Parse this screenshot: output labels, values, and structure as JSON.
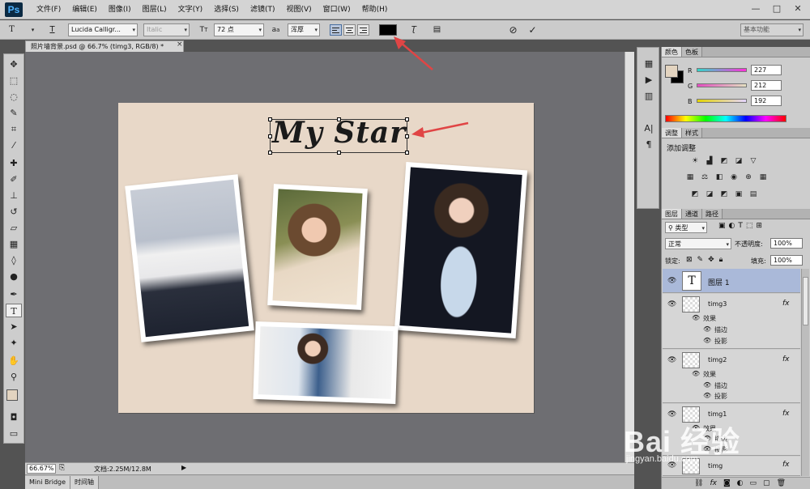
{
  "app": {
    "logo": "Ps",
    "doc_tab": "照片墙背景.psd @ 66.7% (timg3, RGB/8) *",
    "tab_close": "×"
  },
  "menus": [
    "文件(F)",
    "编辑(E)",
    "图像(I)",
    "图层(L)",
    "文字(Y)",
    "选择(S)",
    "滤镜(T)",
    "视图(V)",
    "窗口(W)",
    "帮助(H)"
  ],
  "window_buttons": {
    "minimize": "—",
    "restore": "□",
    "close": "✕"
  },
  "options": {
    "tool_glyph": "T",
    "font_family": "Lucida Calligr...",
    "font_style": "Italic",
    "font_size": "72 点",
    "aa_label": "a",
    "antialias": "浑厚",
    "text_color": "#000000",
    "cancel": "⊘",
    "commit": "✓",
    "workspace": "基本功能"
  },
  "canvas": {
    "title_text": "My Star",
    "doc_bg": "#e8d8c8"
  },
  "status": {
    "zoom": "66.67%",
    "doc_info": "文档:2.25M/12.8M"
  },
  "bottom_tabs": [
    "Mini Bridge",
    "时间轴"
  ],
  "color_panel": {
    "tabs": [
      "颜色",
      "色板"
    ],
    "r_label": "R",
    "g_label": "G",
    "b_label": "B",
    "r": "227",
    "g": "212",
    "b": "192",
    "fg_color": "#e3d4c0",
    "bg_color": "#000000"
  },
  "adjust_panel": {
    "tabs": [
      "调整",
      "样式"
    ],
    "title": "添加调整"
  },
  "layers_panel": {
    "tabs": [
      "图层",
      "通道",
      "路径"
    ],
    "filter_kind": "类型",
    "blend_mode": "正常",
    "opacity_label": "不透明度:",
    "opacity": "100%",
    "lock_label": "锁定:",
    "fill_label": "填充:",
    "fill": "100%",
    "layers": [
      {
        "name": "图层 1",
        "type": "text"
      },
      {
        "name": "timg3",
        "fx": "fx",
        "effects_label": "效果",
        "effects": [
          "描边",
          "投影"
        ]
      },
      {
        "name": "timg2",
        "fx": "fx",
        "effects_label": "效果",
        "effects": [
          "描边",
          "投影"
        ]
      },
      {
        "name": "timg1",
        "fx": "fx",
        "effects_label": "效果",
        "effects": [
          "描边",
          "投影"
        ]
      },
      {
        "name": "timg",
        "fx": "fx"
      }
    ]
  },
  "watermark": {
    "logo": "Bai 经验",
    "url": "jingyan.baidu.com"
  }
}
